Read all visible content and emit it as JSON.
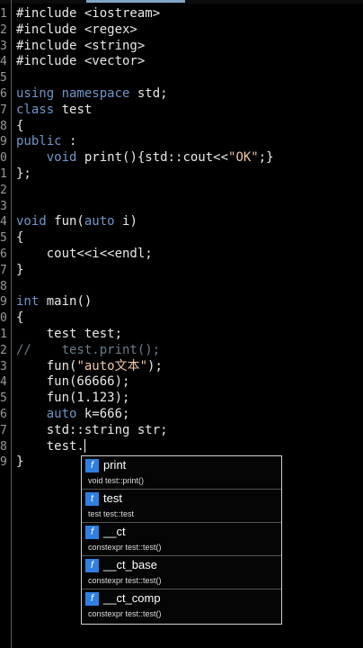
{
  "editor": {
    "lines": [
      {
        "num": "1",
        "html": "#include &lt;iostream&gt;"
      },
      {
        "num": "2",
        "html": "#include &lt;regex&gt;"
      },
      {
        "num": "3",
        "html": "#include &lt;string&gt;"
      },
      {
        "num": "4",
        "html": "#include &lt;vector&gt;"
      },
      {
        "num": "5",
        "html": ""
      },
      {
        "num": "6",
        "html": "<span class=\"kw\">using namespace</span> std;"
      },
      {
        "num": "7",
        "html": "<span class=\"kw\">class</span> test"
      },
      {
        "num": "8",
        "html": "{"
      },
      {
        "num": "9",
        "html": "<span class=\"kw\">public</span> :"
      },
      {
        "num": "0",
        "html": "    <span class=\"kw\">void</span> print(){std::cout&lt;&lt;<span class=\"str\">\"OK\"</span>;}"
      },
      {
        "num": "1",
        "html": "};"
      },
      {
        "num": "2",
        "html": ""
      },
      {
        "num": "3",
        "html": ""
      },
      {
        "num": "4",
        "html": "<span class=\"kw\">void</span> fun(<span class=\"kw\">auto</span> i)"
      },
      {
        "num": "5",
        "html": "{"
      },
      {
        "num": "6",
        "html": "    cout&lt;&lt;i&lt;&lt;endl;"
      },
      {
        "num": "7",
        "html": "}"
      },
      {
        "num": "8",
        "html": ""
      },
      {
        "num": "9",
        "html": "<span class=\"kw\">int</span> main()"
      },
      {
        "num": "0",
        "html": "{"
      },
      {
        "num": "1",
        "html": "    test test;"
      },
      {
        "num": "2",
        "html": "<span class=\"cmt\">//    test.print();</span>"
      },
      {
        "num": "3",
        "html": "    fun(<span class=\"str\">\"auto文本\"</span>);"
      },
      {
        "num": "4",
        "html": "    fun(66666);"
      },
      {
        "num": "5",
        "html": "    fun(1.123);"
      },
      {
        "num": "6",
        "html": "    <span class=\"kw\">auto</span> k=666;"
      },
      {
        "num": "7",
        "html": "    std::string str;"
      },
      {
        "num": "8",
        "html": "    test.<span class=\"cursorblink\"></span>"
      },
      {
        "num": "9",
        "html": "}"
      }
    ]
  },
  "autocomplete": {
    "items": [
      {
        "badge": "f",
        "name": "print",
        "sig": "void test::print()"
      },
      {
        "badge": "t",
        "name": "test",
        "sig": "test test::test"
      },
      {
        "badge": "f",
        "name": "__ct",
        "sig": "constexpr test::test()"
      },
      {
        "badge": "f",
        "name": "__ct_base",
        "sig": "constexpr test::test()"
      },
      {
        "badge": "f",
        "name": "__ct_comp",
        "sig": "constexpr test::test()"
      }
    ]
  }
}
